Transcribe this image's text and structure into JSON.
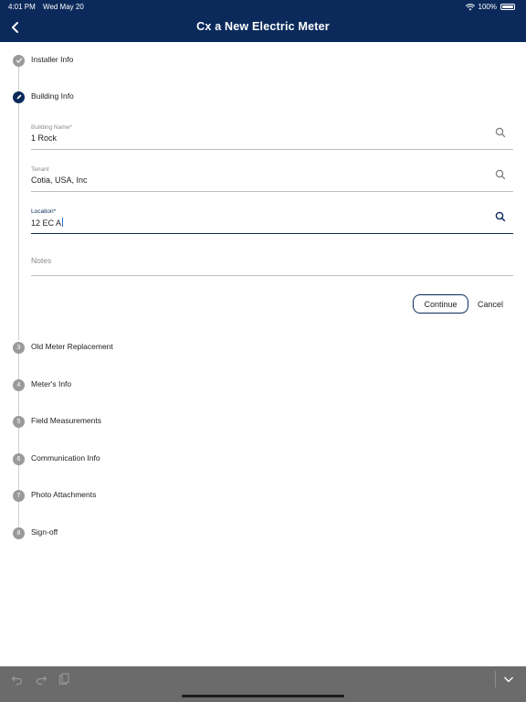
{
  "status_bar": {
    "time": "4:01 PM",
    "date": "Wed May 20",
    "battery": "100%"
  },
  "header": {
    "title": "Cx a New Electric Meter"
  },
  "steps": [
    {
      "number": "",
      "label": "Installer Info",
      "state": "done"
    },
    {
      "number": "",
      "label": "Building Info",
      "state": "active"
    },
    {
      "number": "3",
      "label": "Old Meter Replacement",
      "state": "pending"
    },
    {
      "number": "4",
      "label": "Meter's Info",
      "state": "pending"
    },
    {
      "number": "5",
      "label": "Field Measurements",
      "state": "pending"
    },
    {
      "number": "6",
      "label": "Communication Info",
      "state": "pending"
    },
    {
      "number": "7",
      "label": "Photo Attachments",
      "state": "pending"
    },
    {
      "number": "8",
      "label": "Sign-off",
      "state": "pending"
    }
  ],
  "form": {
    "building_name": {
      "label": "Building Name*",
      "value": "1 Rock"
    },
    "tenant": {
      "label": "Tenant",
      "value": "Cotia, USA, Inc"
    },
    "location": {
      "label": "Location*",
      "value": "12 EC A"
    },
    "notes": {
      "placeholder": "Notes"
    },
    "continue_label": "Continue",
    "cancel_label": "Cancel"
  },
  "colors": {
    "header": "#0b2a5b",
    "accent": "#0b2a5b",
    "toolbar": "#6b6b6b"
  }
}
